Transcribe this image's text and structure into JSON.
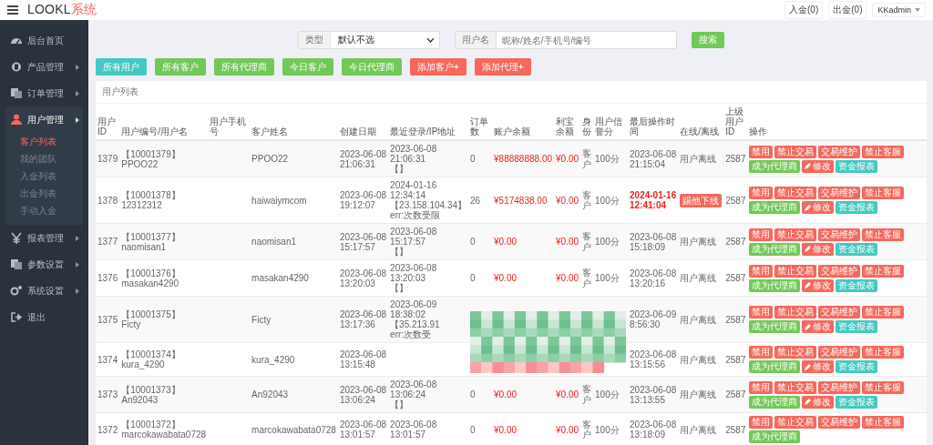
{
  "header": {
    "brand": "LOOKL",
    "brand_accent": "系统",
    "links": [
      "入金(0)",
      "出金(0)"
    ],
    "user": "KKadmin"
  },
  "sidebar": {
    "items": [
      {
        "label": "后台首页",
        "expanded": false,
        "has_arrow": false
      },
      {
        "label": "产品管理",
        "expanded": false,
        "has_arrow": true
      },
      {
        "label": "订单管理",
        "expanded": false,
        "has_arrow": true
      },
      {
        "label": "用户管理",
        "expanded": true,
        "has_arrow": true,
        "children": [
          {
            "label": "客户列表",
            "selected": true
          },
          {
            "label": "我的团队",
            "selected": false
          },
          {
            "label": "入金列表",
            "selected": false
          },
          {
            "label": "出金列表",
            "selected": false
          },
          {
            "label": "手动入金",
            "selected": false
          }
        ]
      },
      {
        "label": "报表管理",
        "expanded": false,
        "has_arrow": true
      },
      {
        "label": "参数设置",
        "expanded": false,
        "has_arrow": true
      },
      {
        "label": "系统设置",
        "expanded": false,
        "has_arrow": true
      },
      {
        "label": "退出",
        "expanded": false,
        "has_arrow": false
      }
    ]
  },
  "filters": {
    "type_label": "类型",
    "type_value": "默认不选",
    "user_label": "用户名",
    "user_placeholder": "昵称/姓名/手机号/编号",
    "search": "搜索"
  },
  "quick_buttons": [
    {
      "label": "所有用户",
      "color": "#45c8c1"
    },
    {
      "label": "所有客户",
      "color": "#72c858"
    },
    {
      "label": "所有代理商",
      "color": "#72c858"
    },
    {
      "label": "今日客户",
      "color": "#72c858"
    },
    {
      "label": "今日代理商",
      "color": "#72c858"
    },
    {
      "label": "添加客户+",
      "color": "#f4695c"
    },
    {
      "label": "添加代理+",
      "color": "#f4695c"
    }
  ],
  "table": {
    "title": "用户列表",
    "columns": [
      "用户ID",
      "用户编号/用户名",
      "用户手机号",
      "客户姓名",
      "创建日期",
      "最近登录/IP地址",
      "订单数",
      "账户余额",
      "利宝余额",
      "身份",
      "用户信誉分",
      "最后操作时间",
      "在线/离线",
      "上级用户ID",
      "操作"
    ],
    "rows": [
      {
        "id": "1379",
        "code": "【10001379】",
        "username": "PPOO22",
        "name": "PPOO22",
        "created": [
          "2023-06-08",
          "21:06:31"
        ],
        "login": [
          "2023-06-08",
          "21:06:31",
          "【】"
        ],
        "orders": "0",
        "balance": "¥88888888.00",
        "yuebao": "¥0.00",
        "identity": "客户",
        "credit": "100分",
        "last_op": [
          "2023-06-08",
          "21:15:04"
        ],
        "last_op_alert": false,
        "online": {
          "kind": "text",
          "label": "用户离线"
        },
        "parent": "2587",
        "covered": false,
        "actions": [
          {
            "label": "禁用",
            "color": "#f4695c",
            "kind": "plain"
          },
          {
            "label": "禁止交易",
            "color": "#f4695c",
            "kind": "plain"
          },
          {
            "label": "交易维护",
            "color": "#f4695c",
            "kind": "plain"
          },
          {
            "label": "禁止客服",
            "color": "#f4695c",
            "kind": "plain"
          },
          {
            "label": "成为代理商",
            "color": "#72c858",
            "kind": "plain"
          },
          {
            "label": "修改",
            "color": "#f4695c",
            "kind": "edit"
          },
          {
            "label": "资金报表",
            "color": "#45c8c1",
            "kind": "plain"
          }
        ]
      },
      {
        "id": "1378",
        "code": "【10001378】",
        "username": "12312312",
        "name": "haiwaiymcom",
        "created": [
          "2023-06-08",
          "19:12:07"
        ],
        "login": [
          "2024-01-16",
          "12:34:14",
          "【23.158.104.34】",
          "err:次数受限"
        ],
        "orders": "26",
        "balance": "¥5174838.00",
        "yuebao": "¥0.00",
        "identity": "客户",
        "credit": "100分",
        "last_op": [
          "2024-01-16",
          "12:41:04"
        ],
        "last_op_alert": true,
        "online": {
          "kind": "badge",
          "label": "踢他下线"
        },
        "parent": "2587",
        "covered": false,
        "actions": [
          {
            "label": "禁用",
            "color": "#f4695c",
            "kind": "plain"
          },
          {
            "label": "禁止交易",
            "color": "#f4695c",
            "kind": "plain"
          },
          {
            "label": "交易维护",
            "color": "#f4695c",
            "kind": "plain"
          },
          {
            "label": "禁止客服",
            "color": "#f4695c",
            "kind": "plain"
          },
          {
            "label": "成为代理商",
            "color": "#72c858",
            "kind": "plain"
          },
          {
            "label": "修改",
            "color": "#f4695c",
            "kind": "edit"
          },
          {
            "label": "资金报表",
            "color": "#45c8c1",
            "kind": "plain"
          }
        ]
      },
      {
        "id": "1377",
        "code": "【10001377】",
        "username": "naomisan1",
        "name": "naomisan1",
        "created": [
          "2023-06-08",
          "15:17:57"
        ],
        "login": [
          "2023-06-08",
          "15:17:57",
          "【】"
        ],
        "orders": "0",
        "balance": "¥0.00",
        "yuebao": "¥0.00",
        "identity": "客户",
        "credit": "100分",
        "last_op": [
          "2023-06-08",
          "15:18:09"
        ],
        "last_op_alert": false,
        "online": {
          "kind": "text",
          "label": "用户离线"
        },
        "parent": "2587",
        "covered": false,
        "actions": [
          {
            "label": "禁用",
            "color": "#f4695c",
            "kind": "plain"
          },
          {
            "label": "禁止交易",
            "color": "#f4695c",
            "kind": "plain"
          },
          {
            "label": "交易维护",
            "color": "#f4695c",
            "kind": "plain"
          },
          {
            "label": "禁止客服",
            "color": "#f4695c",
            "kind": "plain"
          },
          {
            "label": "成为代理商",
            "color": "#72c858",
            "kind": "plain"
          },
          {
            "label": "修改",
            "color": "#f4695c",
            "kind": "edit"
          },
          {
            "label": "资金报表",
            "color": "#45c8c1",
            "kind": "plain"
          }
        ]
      },
      {
        "id": "1376",
        "code": "【10001376】",
        "username": "masakan4290",
        "name": "masakan4290",
        "created": [
          "2023-06-08",
          "13:20:03"
        ],
        "login": [
          "2023-06-08",
          "13:20:03",
          "【】"
        ],
        "orders": "0",
        "balance": "¥0.00",
        "yuebao": "¥0.00",
        "identity": "客户",
        "credit": "100分",
        "last_op": [
          "2023-06-08",
          "13:20:16"
        ],
        "last_op_alert": false,
        "online": {
          "kind": "text",
          "label": "用户离线"
        },
        "parent": "2587",
        "covered": false,
        "actions": [
          {
            "label": "禁用",
            "color": "#f4695c",
            "kind": "plain"
          },
          {
            "label": "禁止交易",
            "color": "#f4695c",
            "kind": "plain"
          },
          {
            "label": "交易维护",
            "color": "#f4695c",
            "kind": "plain"
          },
          {
            "label": "禁止客服",
            "color": "#f4695c",
            "kind": "plain"
          },
          {
            "label": "成为代理商",
            "color": "#72c858",
            "kind": "plain"
          },
          {
            "label": "修改",
            "color": "#f4695c",
            "kind": "edit"
          },
          {
            "label": "资金报表",
            "color": "#45c8c1",
            "kind": "plain"
          }
        ]
      },
      {
        "id": "1375",
        "code": "【10001375】",
        "username": "Ficty",
        "name": "Ficty",
        "created": [
          "2023-06-08",
          "13:17:36"
        ],
        "login": [
          "2023-06-09",
          "18:38:02",
          "【35.213.91",
          "err:次数受"
        ],
        "last_op": [
          "2023-06-09",
          "8:56:30"
        ],
        "last_op_alert": false,
        "online": {
          "kind": "text",
          "label": "用户离线"
        },
        "parent": "2587",
        "covered": true,
        "actions": [
          {
            "label": "禁用",
            "color": "#f4695c",
            "kind": "plain"
          },
          {
            "label": "禁止交易",
            "color": "#f4695c",
            "kind": "plain"
          },
          {
            "label": "交易维护",
            "color": "#f4695c",
            "kind": "plain"
          },
          {
            "label": "禁止客服",
            "color": "#f4695c",
            "kind": "plain"
          },
          {
            "label": "成为代理商",
            "color": "#72c858",
            "kind": "plain"
          },
          {
            "label": "修改",
            "color": "#f4695c",
            "kind": "edit"
          },
          {
            "label": "资金报表",
            "color": "#45c8c1",
            "kind": "plain"
          }
        ]
      },
      {
        "id": "1374",
        "code": "【10001374】",
        "username": "kura_4290",
        "name": "kura_4290",
        "created": [
          "2023-06-08",
          "13:15:48"
        ],
        "last_op": [
          "2023-06-08",
          "13:15:56"
        ],
        "last_op_alert": false,
        "online": {
          "kind": "text",
          "label": "用户离线"
        },
        "parent": "2587",
        "covered": false,
        "actions": [
          {
            "label": "禁用",
            "color": "#f4695c",
            "kind": "plain"
          },
          {
            "label": "禁止交易",
            "color": "#f4695c",
            "kind": "plain"
          },
          {
            "label": "交易维护",
            "color": "#f4695c",
            "kind": "plain"
          },
          {
            "label": "禁止客服",
            "color": "#f4695c",
            "kind": "plain"
          },
          {
            "label": "成为代理商",
            "color": "#72c858",
            "kind": "plain"
          },
          {
            "label": "修改",
            "color": "#f4695c",
            "kind": "edit"
          },
          {
            "label": "资金报表",
            "color": "#45c8c1",
            "kind": "plain"
          }
        ]
      },
      {
        "id": "1373",
        "code": "【10001373】",
        "username": "An92043",
        "name": "An92043",
        "created": [
          "2023-06-08",
          "13:06:24"
        ],
        "login": [
          "2023-06-08",
          "13:06:24",
          "【】"
        ],
        "orders": "0",
        "balance": "¥0.00",
        "yuebao": "¥0.00",
        "identity": "客户",
        "credit": "100分",
        "last_op": [
          "2023-06-08",
          "13:13:55"
        ],
        "last_op_alert": false,
        "online": {
          "kind": "text",
          "label": "用户离线"
        },
        "parent": "2587",
        "covered": false,
        "actions": [
          {
            "label": "禁用",
            "color": "#f4695c",
            "kind": "plain"
          },
          {
            "label": "禁止交易",
            "color": "#f4695c",
            "kind": "plain"
          },
          {
            "label": "交易维护",
            "color": "#f4695c",
            "kind": "plain"
          },
          {
            "label": "禁止客服",
            "color": "#f4695c",
            "kind": "plain"
          },
          {
            "label": "成为代理商",
            "color": "#72c858",
            "kind": "plain"
          },
          {
            "label": "修改",
            "color": "#f4695c",
            "kind": "edit"
          },
          {
            "label": "资金报表",
            "color": "#45c8c1",
            "kind": "plain"
          }
        ]
      },
      {
        "id": "1372",
        "code": "【10001372】",
        "username": "marcokawabata0728",
        "name": "marcokawabata0728",
        "created": [
          "2023-06-08",
          "13:01:57"
        ],
        "login": [
          "2023-06-08",
          "13:01:57"
        ],
        "orders": "0",
        "balance": "¥0.00",
        "yuebao": "¥0.00",
        "identity": "客户",
        "credit": "100分",
        "last_op": [
          "2023-06-08",
          "13:18:09"
        ],
        "last_op_alert": false,
        "online": {
          "kind": "text",
          "label": "用户离线"
        },
        "parent": "2587",
        "covered": false,
        "actions": [
          {
            "label": "禁用",
            "color": "#f4695c",
            "kind": "plain"
          },
          {
            "label": "禁止交易",
            "color": "#f4695c",
            "kind": "plain"
          },
          {
            "label": "交易维护",
            "color": "#f4695c",
            "kind": "plain"
          },
          {
            "label": "禁止客服",
            "color": "#f4695c",
            "kind": "plain"
          },
          {
            "label": "成为代理商",
            "color": "#72c858",
            "kind": "plain"
          }
        ]
      }
    ]
  }
}
